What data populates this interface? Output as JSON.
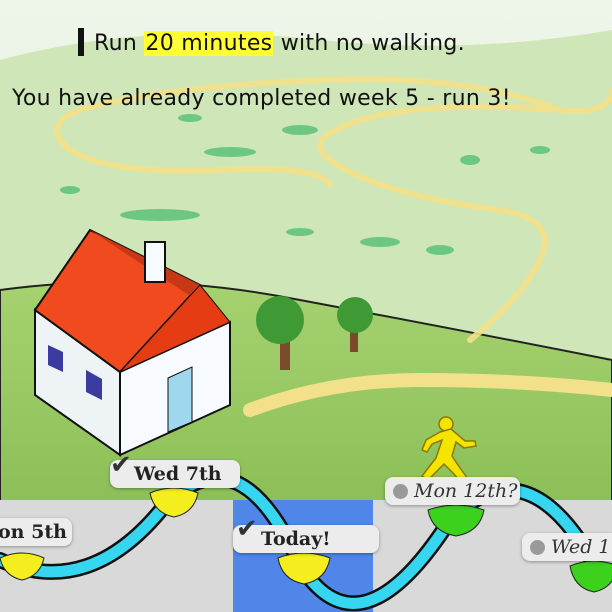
{
  "instruction": {
    "prefix": "Run ",
    "highlight": "20 minutes",
    "suffix": " with no walking."
  },
  "status": "You have already completed week 5 - run 3!",
  "timeline": {
    "days": [
      {
        "label": "on 5th",
        "state": "completed"
      },
      {
        "label": "Wed 7th",
        "state": "completed"
      },
      {
        "label": "Today!",
        "state": "today"
      },
      {
        "label": "Mon 12th?",
        "state": "future"
      },
      {
        "label": "Wed 1",
        "state": "future"
      }
    ]
  },
  "colors": {
    "sky": "#dfeeda",
    "hill": "#8fc25b",
    "path": "#f2e08a",
    "track": "#37d6f0",
    "today_column": "#4f86e8",
    "completed_node": "#f4ee1e",
    "future_node": "#3bd11c",
    "roof": "#f04a1e",
    "runner": "#f5e400"
  },
  "icons": {
    "house": "house-icon",
    "runner": "runner-icon",
    "tree": "tree-icon",
    "check": "check-icon"
  }
}
